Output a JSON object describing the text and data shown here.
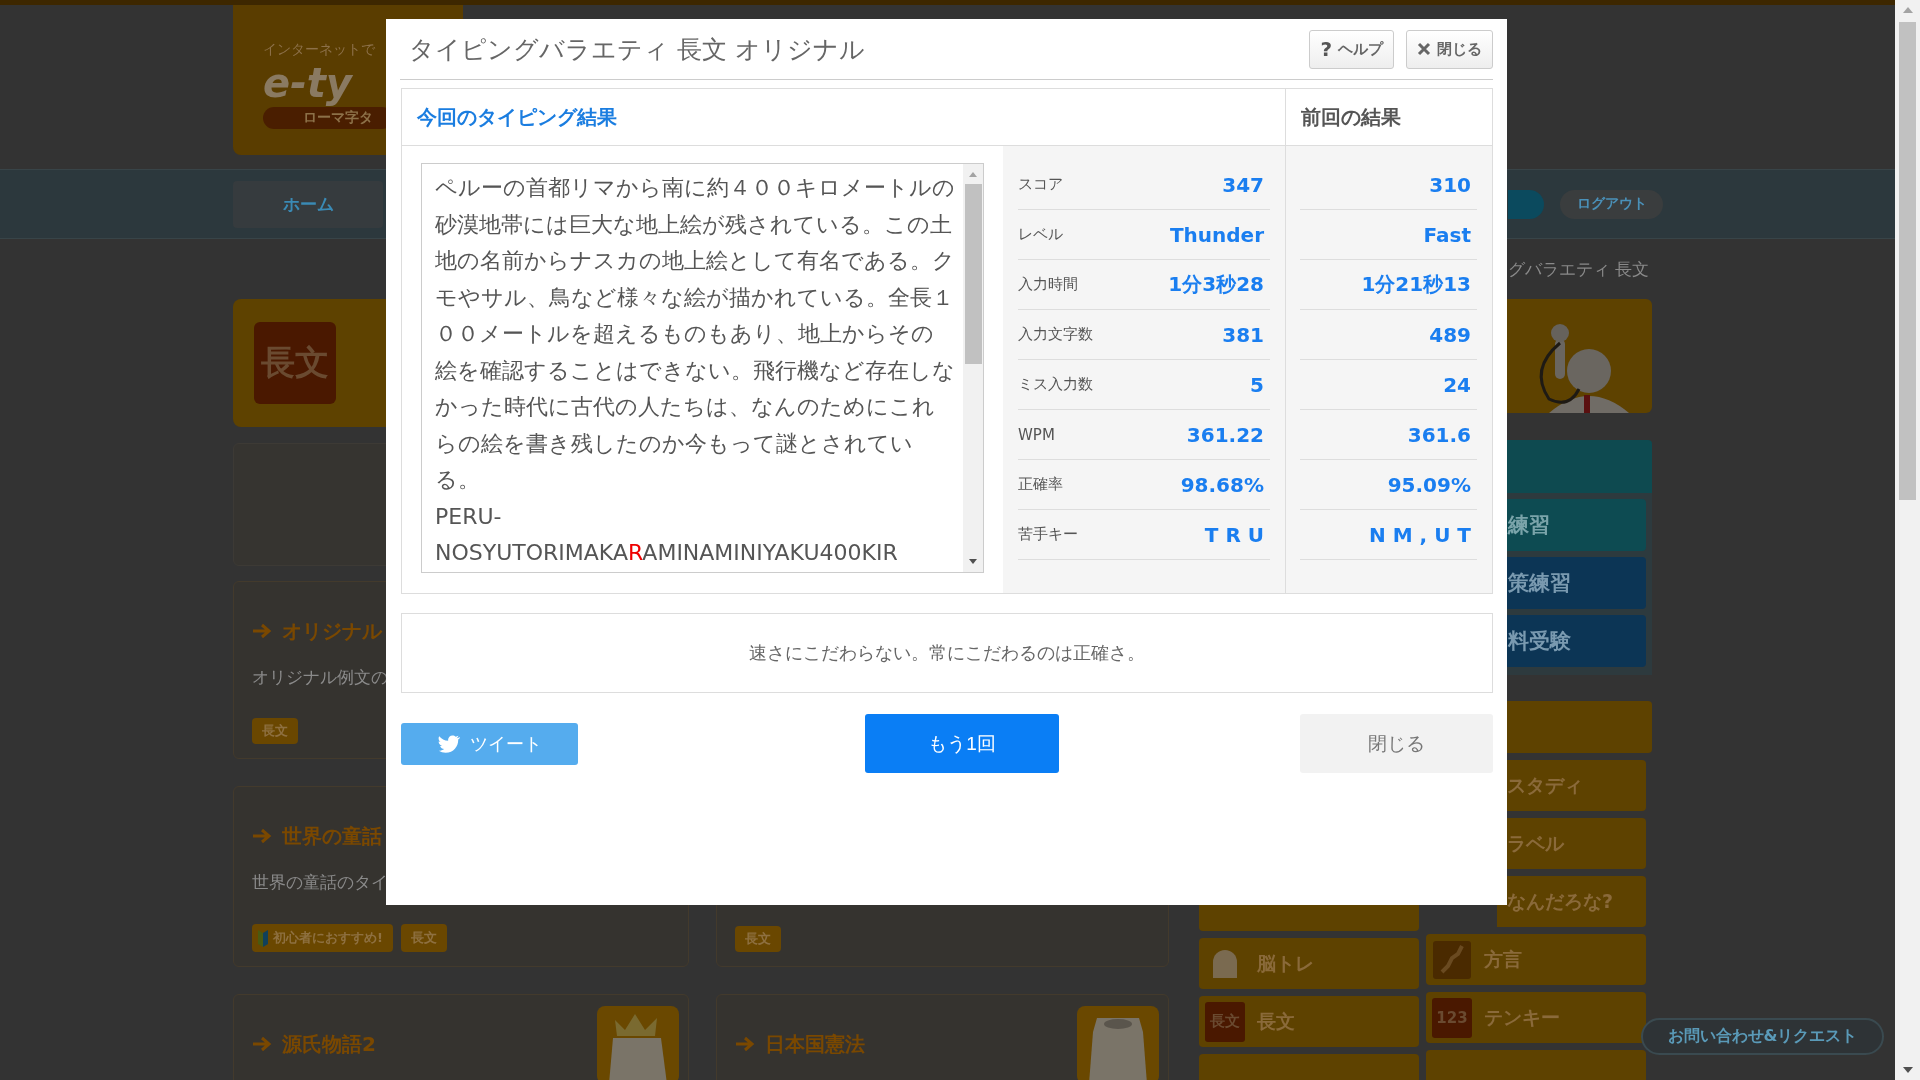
{
  "background_page": {
    "logo": {
      "tagline": "インターネットで",
      "wordmark": "e-ty",
      "badge": "ローマ字タ"
    },
    "nav": {
      "home": "ホーム",
      "logout": "ログアウト"
    },
    "breadcrumb": "グバラエティ 長文",
    "hero": {
      "icon_text": "長文"
    },
    "left_cards": [
      {
        "title": "オリジナル",
        "description": "オリジナル例文の",
        "tags": [
          {
            "label": "長文",
            "kind": "plain"
          }
        ]
      },
      {
        "title": "世界の童話",
        "description": "世界の童話のタイ",
        "tags": [
          {
            "label": "初心者におすすめ!",
            "kind": "beginner"
          },
          {
            "label": "長文",
            "kind": "plain"
          }
        ]
      },
      {
        "title": "源氏物語2",
        "kind": "crown"
      }
    ],
    "right_cards": [
      {
        "tags": [
          {
            "label": "長文",
            "kind": "plain"
          }
        ]
      },
      {
        "title": "日本国憲法",
        "kind": "box"
      }
    ],
    "sidebar": {
      "practice_buttons": [
        "練習",
        "策練習",
        "料受験"
      ],
      "left_tiles": [
        {
          "kind": "plain"
        },
        {
          "label": "脳トレ",
          "kind": "head"
        },
        {
          "label": "長文",
          "kind": "text",
          "icon_text": "長文"
        },
        {
          "kind": "plain"
        }
      ],
      "right_tiles": [
        {
          "label": "スタディ",
          "kind": "plain"
        },
        {
          "label": "ラベル",
          "kind": "plain"
        },
        {
          "label": "なんだろな?",
          "kind": "plain"
        },
        {
          "label": "方言",
          "kind": "map"
        },
        {
          "label": "テンキー",
          "kind": "text",
          "icon_text": "123"
        },
        {
          "kind": "plain"
        }
      ]
    },
    "contact_button": "お問い合わせ&リクエスト"
  },
  "dialog": {
    "title": "タイピングバラエティ 長文 オリジナル",
    "help_button": {
      "icon_char": "?",
      "label": "ヘルプ"
    },
    "close_button": "閉じる",
    "current_heading": "今回のタイピング結果",
    "previous_heading": "前回の結果",
    "passage": {
      "text": "ペルーの首都リマから南に約４００キロメートルの砂漠地帯には巨大な地上絵が残されている。この土地の名前からナスカの地上絵として有名である。クモやサル、鳥など様々な絵が描かれている。全長１００メートルを超えるものもあり、地上からその絵を確認することはできない。飛行機など存在しなかった時代に古代の人たちは、なんのためにこれらの絵を書き残したのか今もって謎とされている。",
      "romaji": [
        {
          "text": "PERU-NOSYUTORIMAKA",
          "miss": false
        },
        {
          "text": "R",
          "miss": true
        },
        {
          "text": "AMINAMINIYAKU400KIR",
          "miss": false
        }
      ]
    },
    "stats": [
      {
        "label": "スコア",
        "current": "347",
        "previous": "310"
      },
      {
        "label": "レベル",
        "current": "Thunder",
        "previous": "Fast"
      },
      {
        "label": "入力時間",
        "current": "1分3秒28",
        "previous": "1分21秒13"
      },
      {
        "label": "入力文字数",
        "current": "381",
        "previous": "489"
      },
      {
        "label": "ミス入力数",
        "current": "5",
        "previous": "24"
      },
      {
        "label": "WPM",
        "current": "361.22",
        "previous": "361.6"
      },
      {
        "label": "正確率",
        "current": "98.68%",
        "previous": "95.09%"
      },
      {
        "label": "苦手キー",
        "current": "T R U",
        "previous": "N M , U T"
      }
    ],
    "message": "速さにこだわらない。常にこだわるのは正確さ。",
    "actions": {
      "tweet": "ツイート",
      "retry": "もう1回",
      "close": "閉じる"
    }
  }
}
